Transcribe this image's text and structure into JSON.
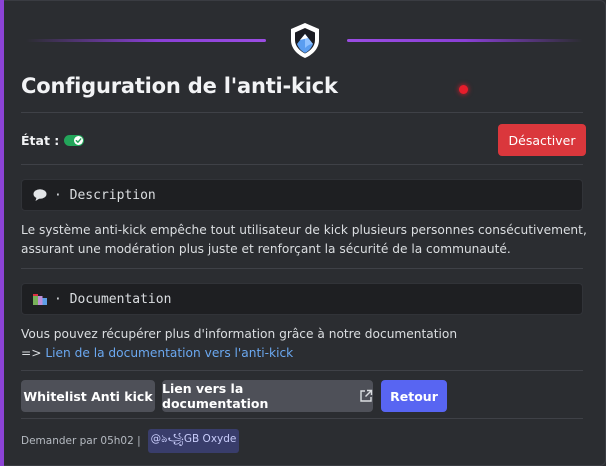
{
  "title": "Configuration de l'anti-kick",
  "etat": {
    "label": "État :",
    "enabled": true
  },
  "actions": {
    "deactivate_label": "Désactiver"
  },
  "description": {
    "heading_sep": "·",
    "heading": "Description",
    "text": "Le système anti-kick empêche tout utilisateur de kick plusieurs personnes consécutivement, assurant une modération plus juste et renforçant la sécurité de la communauté."
  },
  "documentation": {
    "heading_sep": "·",
    "heading": "Documentation",
    "text": "Vous pouvez récupérer plus d'information grâce à notre documentation",
    "arrow": "=>",
    "link_text": "Lien de la documentation vers l'anti-kick"
  },
  "buttons": {
    "whitelist": "Whitelist Anti kick",
    "doc_link": "Lien vers la documentation",
    "back": "Retour"
  },
  "footer": {
    "requested_by": "Demander par 05h02 |",
    "mention": "@ঌ꧁GB Oxyde"
  },
  "colors": {
    "accent": "#8c43d6",
    "danger": "#da373c",
    "primary": "#5865f2",
    "secondary": "#4e5058",
    "toggle_on": "#23a55a"
  },
  "icons": {
    "logo": "shield-logo-icon",
    "status": "toggle-check-icon",
    "description": "speech-bubble-icon",
    "documentation": "books-icon",
    "external": "external-link-icon"
  }
}
